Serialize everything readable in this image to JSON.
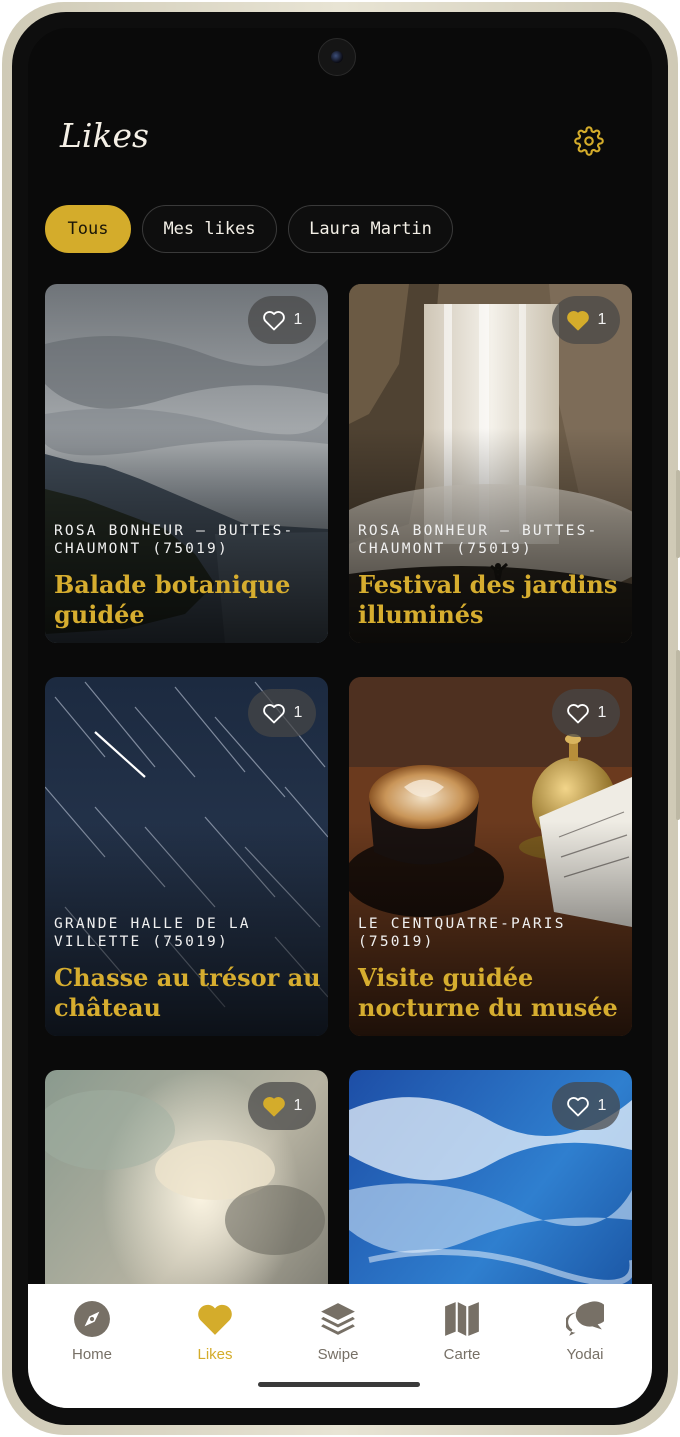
{
  "header": {
    "title": "Likes",
    "settings_icon": "gear-icon"
  },
  "filters": [
    {
      "label": "Tous",
      "active": true
    },
    {
      "label": "Mes likes",
      "active": false
    },
    {
      "label": "Laura Martin",
      "active": false
    }
  ],
  "cards": [
    {
      "location": "ROSA BONHEUR — BUTTES-CHAUMONT (75019)",
      "title": "Balade botanique guidée",
      "likes": "1",
      "liked": false
    },
    {
      "location": "ROSA BONHEUR — BUTTES-CHAUMONT (75019)",
      "title": "Festival des jardins illuminés",
      "likes": "1",
      "liked": true
    },
    {
      "location": "GRANDE HALLE DE LA VILLETTE (75019)",
      "title": "Chasse au trésor au château",
      "likes": "1",
      "liked": false
    },
    {
      "location": "LE CENTQUATRE-PARIS (75019)",
      "title": "Visite guidée nocturne du musée",
      "likes": "1",
      "liked": false
    },
    {
      "location": "",
      "title": "",
      "likes": "1",
      "liked": true
    },
    {
      "location": "",
      "title": "",
      "likes": "1",
      "liked": false
    }
  ],
  "nav": [
    {
      "label": "Home",
      "icon": "compass-icon",
      "active": false
    },
    {
      "label": "Likes",
      "icon": "heart-icon",
      "active": true
    },
    {
      "label": "Swipe",
      "icon": "layers-icon",
      "active": false
    },
    {
      "label": "Carte",
      "icon": "map-icon",
      "active": false
    },
    {
      "label": "Yodai",
      "icon": "chat-bubbles-icon",
      "active": false
    }
  ],
  "colors": {
    "accent": "#d4ac2b",
    "background": "#0a0a0a",
    "nav_inactive": "#777066"
  }
}
